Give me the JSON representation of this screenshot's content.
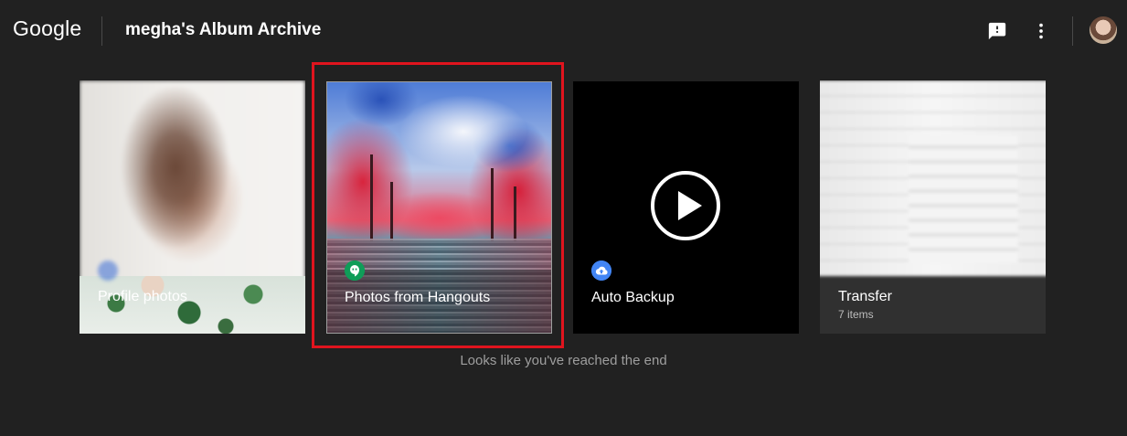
{
  "header": {
    "logo": "Google",
    "title": "megha's Album Archive",
    "feedback_icon": "feedback-icon",
    "more_icon": "more-vert-icon",
    "avatar_icon": "account-avatar"
  },
  "albums": [
    {
      "label": "Profile photos",
      "sub": ""
    },
    {
      "label": "Photos from Hangouts",
      "sub": "",
      "badge_icon": "hangouts-icon",
      "badge_color": "#0f9d58"
    },
    {
      "label": "Auto Backup",
      "sub": "",
      "badge_icon": "cloud-upload-icon",
      "badge_color": "#4285f4"
    },
    {
      "label": "Transfer",
      "sub": "7 items"
    }
  ],
  "highlight_color": "#e0141e",
  "end_message": "Looks like you've reached the end"
}
